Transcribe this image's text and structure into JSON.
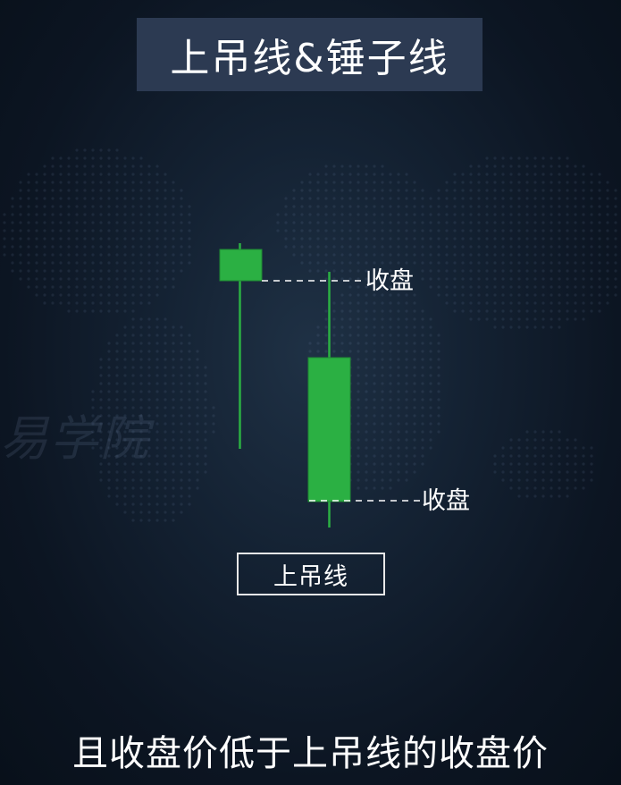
{
  "header": {
    "title": "上吊线&锤子线"
  },
  "watermark": {
    "text": "易学院"
  },
  "diagram": {
    "candles": [
      {
        "color": "#2bb043",
        "role": "previous-hanging-man"
      },
      {
        "color": "#2bb043",
        "role": "current"
      }
    ],
    "close_labels": [
      "收盘",
      "收盘"
    ],
    "name_label": "上吊线"
  },
  "subtitle": {
    "text": "且收盘价低于上吊线的收盘价"
  },
  "colors": {
    "background": "#0b1320",
    "title_bg": "#2c3a52",
    "candle_green": "#2bb043",
    "dashed_line": "#ffffff"
  }
}
